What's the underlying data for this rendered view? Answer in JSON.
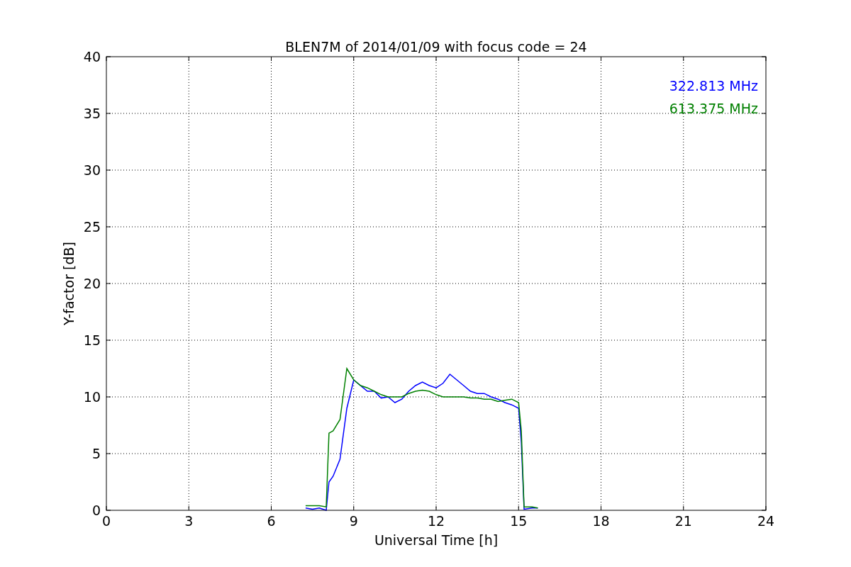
{
  "chart_data": {
    "type": "line",
    "title": "BLEN7M of 2014/01/09 with focus code = 24",
    "xlabel": "Universal Time [h]",
    "ylabel": "Y-factor [dB]",
    "x": [
      7.25,
      7.5,
      7.75,
      8.0,
      8.1,
      8.25,
      8.5,
      8.75,
      9.0,
      9.25,
      9.5,
      9.75,
      10.0,
      10.25,
      10.5,
      10.75,
      11.0,
      11.25,
      11.5,
      11.75,
      12.0,
      12.25,
      12.5,
      12.75,
      13.0,
      13.25,
      13.5,
      13.75,
      14.0,
      14.25,
      14.5,
      14.75,
      15.0,
      15.1,
      15.2,
      15.5,
      15.7
    ],
    "series": [
      {
        "name": "322.813 MHz",
        "color": "#0000ff",
        "values": [
          0.2,
          0.1,
          0.2,
          0.0,
          2.5,
          3.0,
          4.5,
          9.0,
          11.5,
          11.0,
          10.5,
          10.5,
          9.9,
          10.0,
          9.5,
          9.8,
          10.5,
          11.0,
          11.3,
          11.0,
          10.8,
          11.2,
          12.0,
          11.5,
          11.0,
          10.5,
          10.3,
          10.3,
          10.0,
          9.8,
          9.5,
          9.3,
          9.0,
          6.0,
          0.1,
          0.2,
          0.2
        ]
      },
      {
        "name": "613.375 MHz",
        "color": "#008000",
        "values": [
          0.4,
          0.4,
          0.4,
          0.3,
          6.8,
          7.0,
          8.0,
          12.5,
          11.5,
          11.0,
          10.8,
          10.5,
          10.2,
          10.0,
          10.0,
          10.0,
          10.3,
          10.5,
          10.6,
          10.5,
          10.2,
          10.0,
          10.0,
          10.0,
          10.0,
          9.9,
          9.9,
          9.8,
          9.8,
          9.6,
          9.7,
          9.8,
          9.5,
          7.0,
          0.3,
          0.3,
          0.2
        ]
      }
    ],
    "grid": true,
    "xlim": [
      0,
      24
    ],
    "ylim": [
      0,
      40
    ],
    "xticks": [
      0,
      3,
      6,
      9,
      12,
      15,
      18,
      21,
      24
    ],
    "yticks": [
      0,
      5,
      10,
      15,
      20,
      25,
      30,
      35,
      40
    ]
  }
}
